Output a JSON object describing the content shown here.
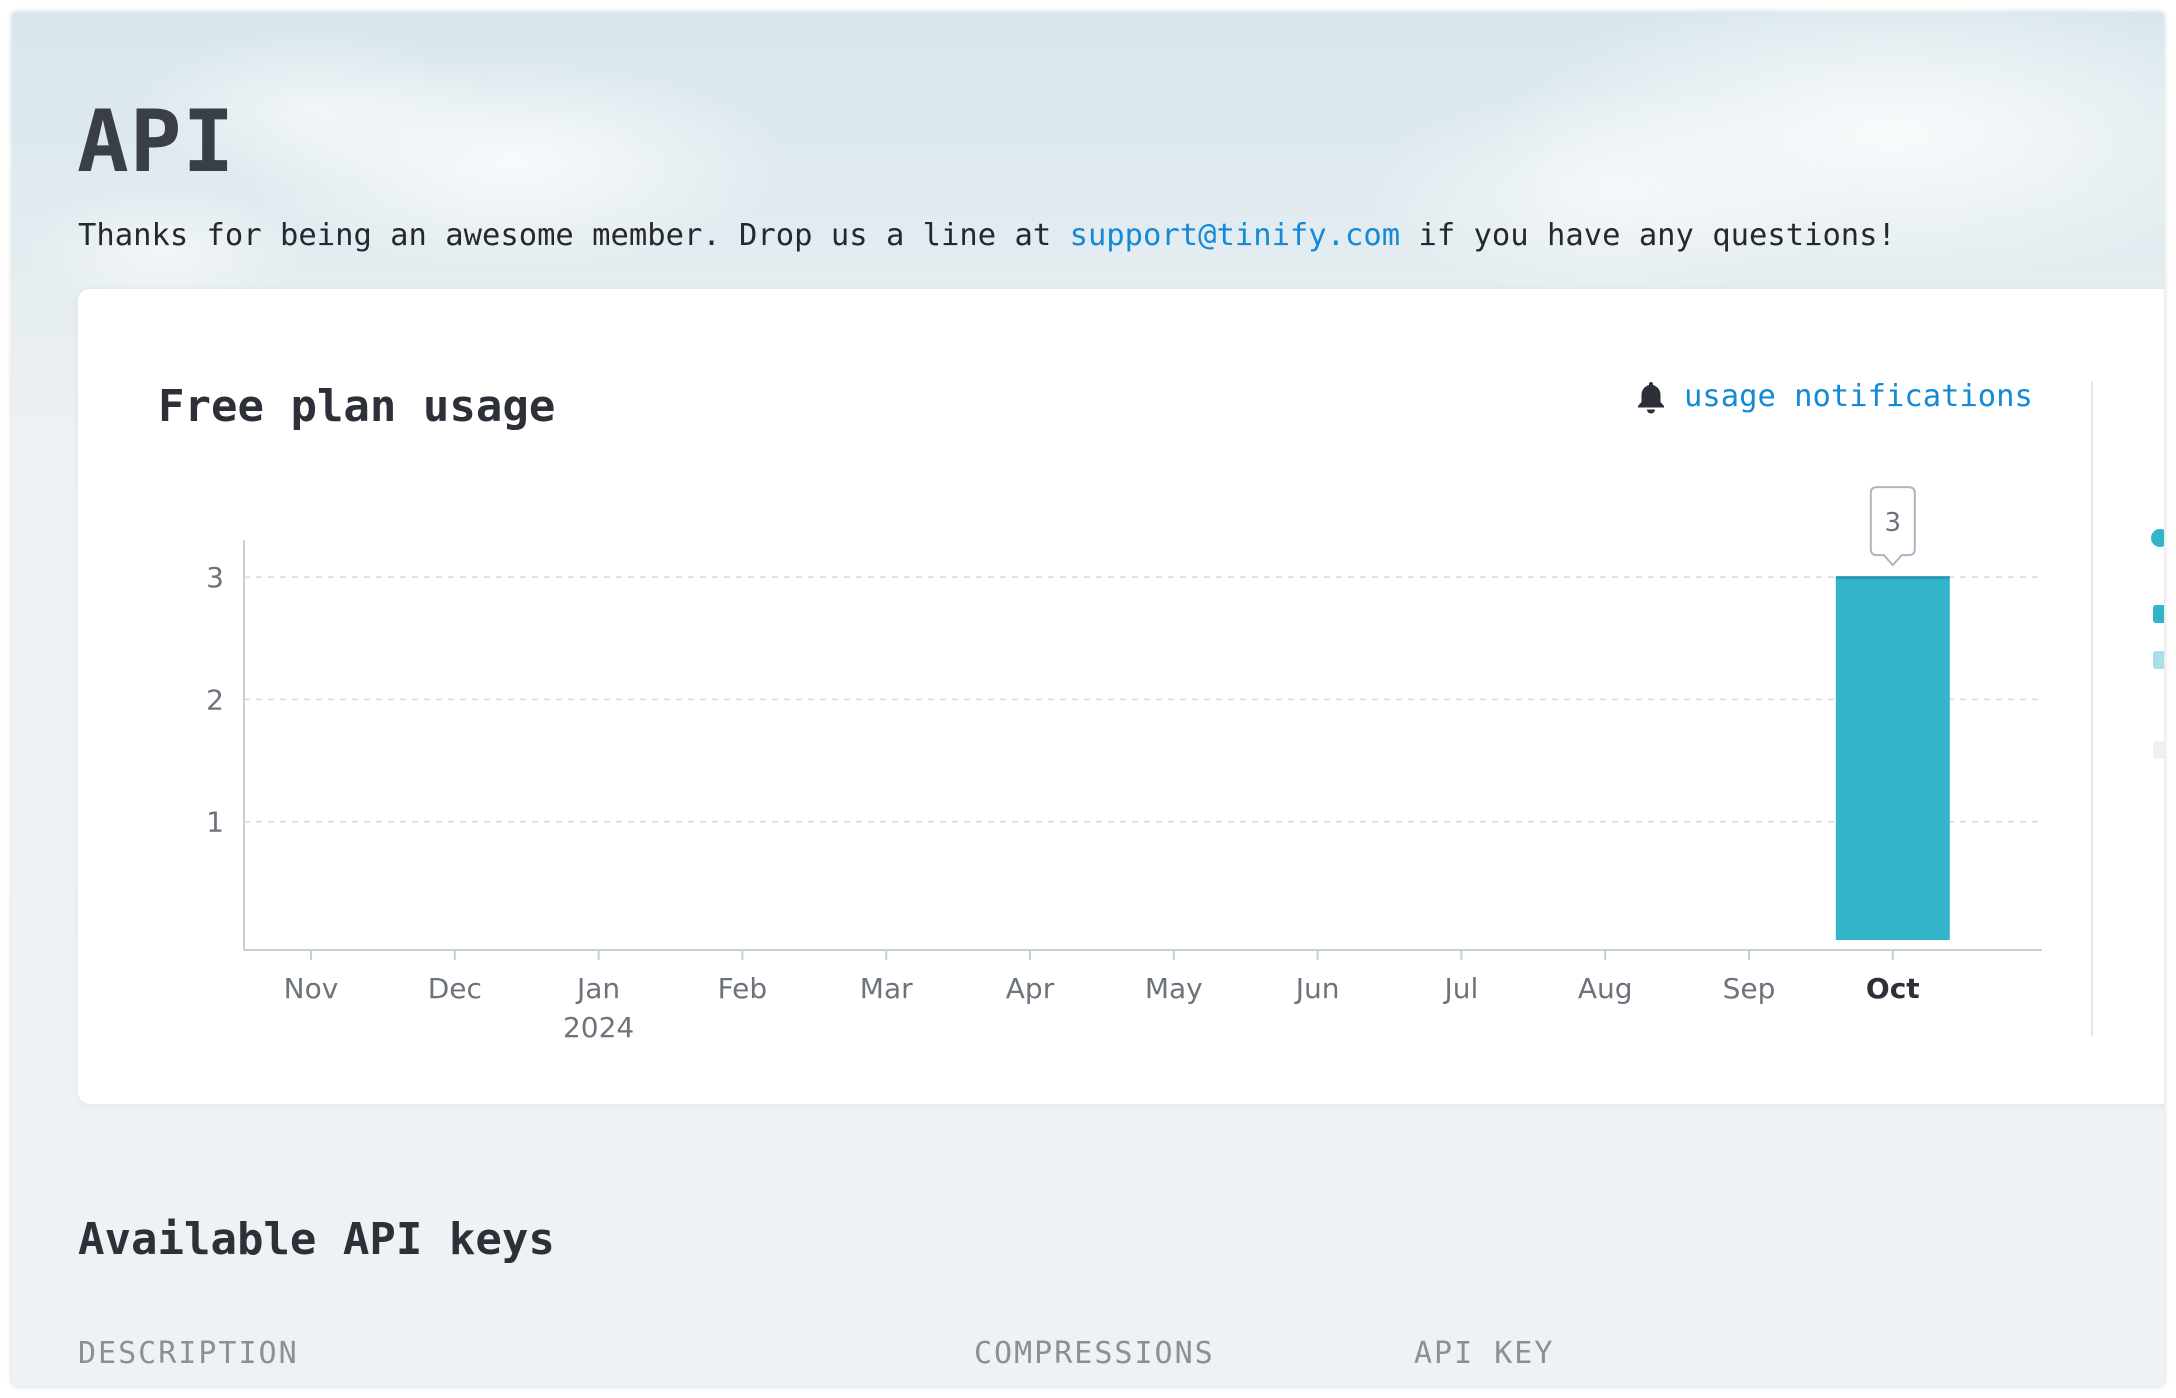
{
  "page": {
    "title": "API",
    "intro_before": "Thanks for being an awesome member. Drop us a line at ",
    "support_email": "support@tinify.com",
    "intro_after": " if you have any questions!"
  },
  "usage_card": {
    "title": "Free plan usage",
    "notifications_label": "usage notifications",
    "notifications_icon": "bell-icon",
    "accent_color": "#32b4cb",
    "link_color": "#1489d6"
  },
  "chart_data": {
    "type": "bar",
    "title": "",
    "xlabel": "",
    "ylabel": "",
    "categories": [
      "Nov",
      "Dec",
      "Jan",
      "Feb",
      "Mar",
      "Apr",
      "May",
      "Jun",
      "Jul",
      "Aug",
      "Sep",
      "Oct"
    ],
    "category_sublabels": [
      "",
      "",
      "2024",
      "",
      "",
      "",
      "",
      "",
      "",
      "",
      "",
      ""
    ],
    "highlighted_category": "Oct",
    "values": [
      0,
      0,
      0,
      0,
      0,
      0,
      0,
      0,
      0,
      0,
      0,
      3
    ],
    "yticks": [
      1,
      2,
      3
    ],
    "ylim": [
      0,
      3.3
    ],
    "grid": true,
    "grid_style": "dashed",
    "value_callout": "3",
    "bar_color": "#32b4cb"
  },
  "api_keys": {
    "title": "Available API keys",
    "columns": [
      "DESCRIPTION",
      "COMPRESSIONS",
      "API KEY"
    ]
  }
}
